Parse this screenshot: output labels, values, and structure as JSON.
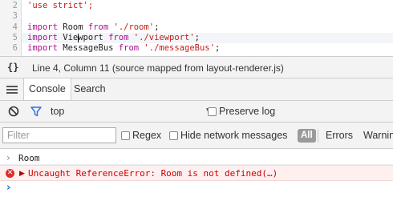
{
  "editor": {
    "lines": [
      {
        "num": "2",
        "parts": [
          [
            "str",
            "'use strict';"
          ]
        ]
      },
      {
        "num": "3",
        "parts": []
      },
      {
        "num": "4",
        "parts": [
          [
            "kw",
            "import"
          ],
          [
            "",
            " Room "
          ],
          [
            "kw",
            "from"
          ],
          [
            "",
            " "
          ],
          [
            "str",
            "'./room'"
          ],
          [
            "",
            ";"
          ]
        ]
      },
      {
        "num": "5",
        "parts": [
          [
            "kw",
            "import"
          ],
          [
            "",
            " Viewport "
          ],
          [
            "kw",
            "from"
          ],
          [
            "",
            " "
          ],
          [
            "str",
            "'./viewport'"
          ],
          [
            "",
            ";"
          ]
        ]
      },
      {
        "num": "6",
        "parts": [
          [
            "kw",
            "import"
          ],
          [
            "",
            " MessageBus "
          ],
          [
            "kw",
            "from"
          ],
          [
            "",
            " "
          ],
          [
            "str",
            "'./messageBus'"
          ],
          [
            "",
            ";"
          ]
        ]
      }
    ]
  },
  "status": {
    "icon": "{}",
    "text": "Line 4, Column 11  (source mapped from layout-renderer.js)"
  },
  "tabs": {
    "console": "Console",
    "search": "Search"
  },
  "toolbar": {
    "context": "top",
    "preserve_log": "Preserve log"
  },
  "filterbar": {
    "placeholder": "Filter",
    "regex": "Regex",
    "hide_network": "Hide network messages",
    "all": "All",
    "errors": "Errors",
    "warnings": "Warnings"
  },
  "console": {
    "log_message": "Room",
    "error_message": "Uncaught ReferenceError: Room is not defined(…)"
  },
  "colors": {
    "keyword": "#aa0d91",
    "string": "#c41a16",
    "error": "#cc0000",
    "error_bg": "#fff0f0",
    "accent": "#2b6ce6"
  }
}
